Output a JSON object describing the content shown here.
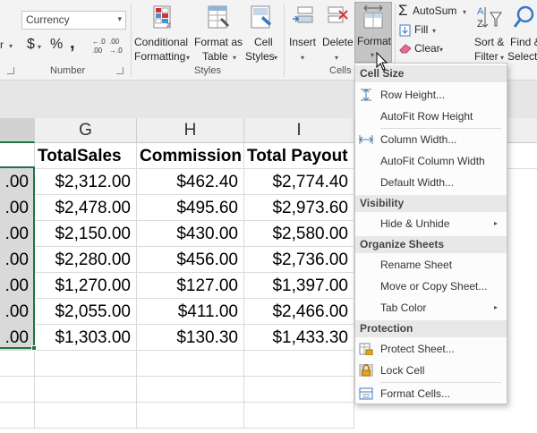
{
  "ribbon": {
    "number_format_value": "Currency",
    "currency_symbol": "$",
    "percent_symbol": "%",
    "comma_symbol": ",",
    "increase_decimal_label": ".00",
    "decrease_decimal_label": "→.0",
    "number_group_label": "Number",
    "conditional_formatting_label_1": "Conditional",
    "conditional_formatting_label_2": "Formatting",
    "format_as_table_label_1": "Format as",
    "format_as_table_label_2": "Table",
    "cell_styles_label_1": "Cell",
    "cell_styles_label_2": "Styles",
    "styles_group_label": "Styles",
    "insert_label": "Insert",
    "delete_label": "Delete",
    "format_label": "Format",
    "cells_group_label": "Cells",
    "autosum_label": "AutoSum",
    "fill_label": "Fill",
    "clear_label": "Clear",
    "sort_filter_label_1": "Sort &",
    "sort_filter_label_2": "Filter",
    "find_select_label_1": "Find &",
    "find_select_label_2": "Select",
    "left_fragment": "r"
  },
  "sheet": {
    "columns": [
      {
        "letter": "",
        "selected": true
      },
      {
        "letter": "G",
        "selected": false
      },
      {
        "letter": "H",
        "selected": false
      },
      {
        "letter": "I",
        "selected": false
      },
      {
        "letter": "",
        "selected": false
      }
    ],
    "headers": [
      "",
      "TotalSales",
      "Commission",
      "Total Payout"
    ],
    "rows": [
      [
        ".00",
        "$2,312.00",
        "$462.40",
        "$2,774.40"
      ],
      [
        ".00",
        "$2,478.00",
        "$495.60",
        "$2,973.60"
      ],
      [
        ".00",
        "$2,150.00",
        "$430.00",
        "$2,580.00"
      ],
      [
        ".00",
        "$2,280.00",
        "$456.00",
        "$2,736.00"
      ],
      [
        ".00",
        "$1,270.00",
        "$127.00",
        "$1,397.00"
      ],
      [
        ".00",
        "$2,055.00",
        "$411.00",
        "$2,466.00"
      ],
      [
        ".00",
        "$1,303.00",
        "$130.30",
        "$1,433.30"
      ]
    ]
  },
  "format_menu": {
    "sections": {
      "cell_size": "Cell Size",
      "visibility": "Visibility",
      "organize": "Organize Sheets",
      "protection": "Protection"
    },
    "items": {
      "row_height": "Row Height...",
      "autofit_row": "AutoFit Row Height",
      "column_width": "Column Width...",
      "autofit_column": "AutoFit Column Width",
      "default_width": "Default Width...",
      "hide_unhide": "Hide & Unhide",
      "rename_sheet": "Rename Sheet",
      "move_copy": "Move or Copy Sheet...",
      "tab_color": "Tab Color",
      "protect_sheet": "Protect Sheet...",
      "lock_cell": "Lock Cell",
      "format_cells": "Format Cells..."
    }
  },
  "colors": {
    "excel_green": "#217346",
    "ribbon_bg": "#f3f3f3",
    "selected_fill": "#d9d9d9"
  }
}
